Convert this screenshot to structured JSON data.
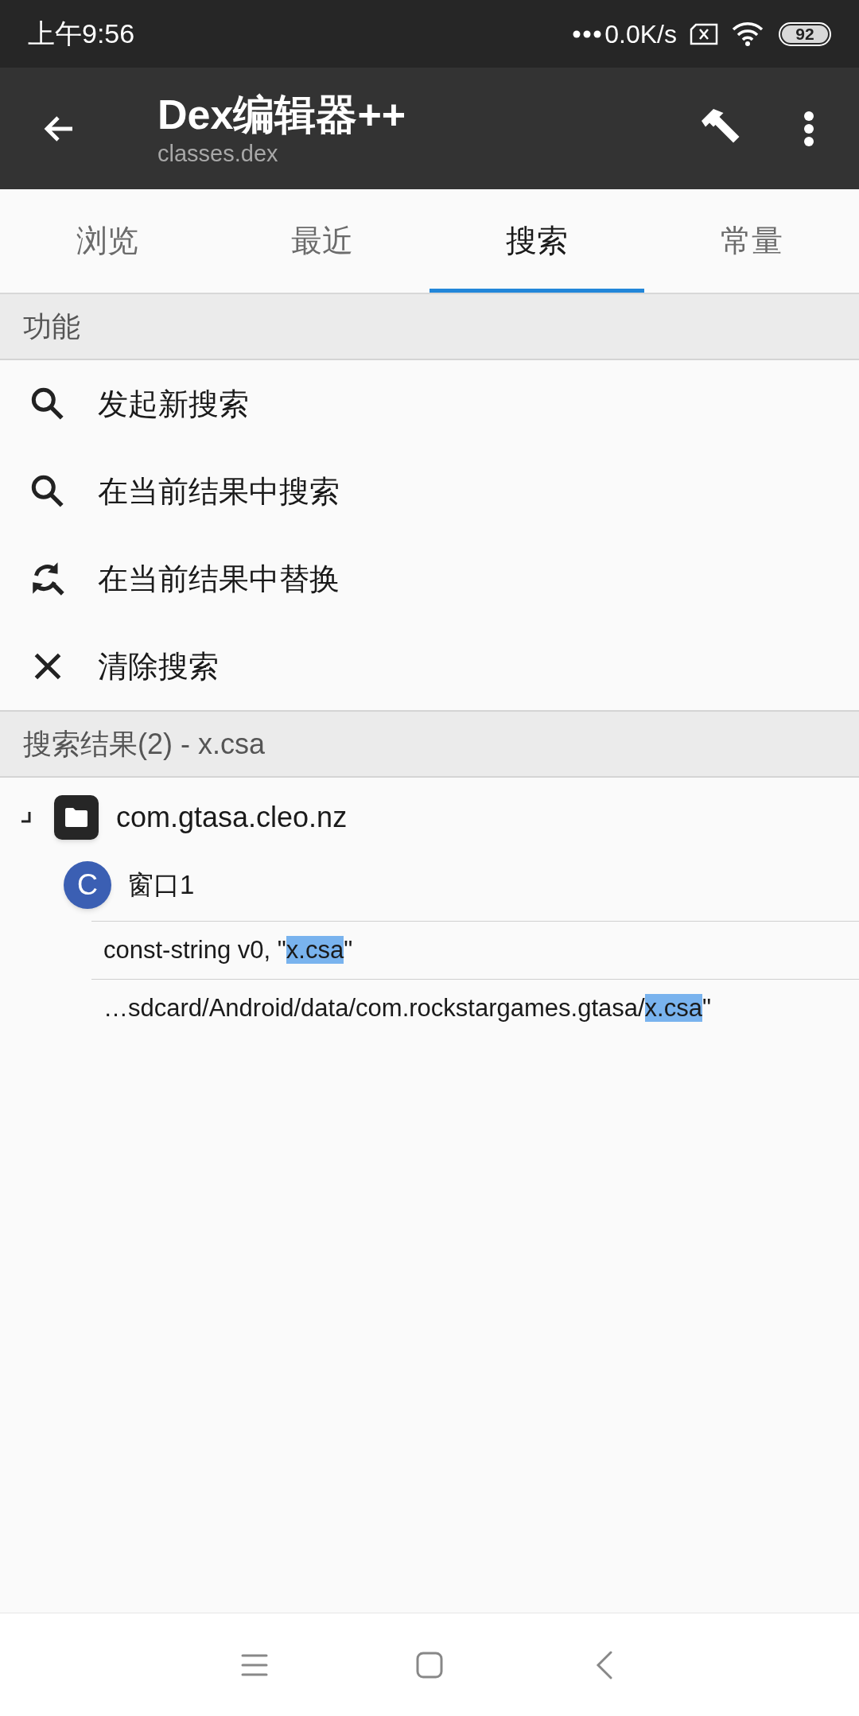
{
  "status_bar": {
    "time": "上午9:56",
    "speed": "0.0K/s",
    "battery": "92"
  },
  "app_bar": {
    "title": "Dex编辑器++",
    "subtitle": "classes.dex"
  },
  "tabs": [
    {
      "label": "浏览",
      "selected": false
    },
    {
      "label": "最近",
      "selected": false
    },
    {
      "label": "搜索",
      "selected": true
    },
    {
      "label": "常量",
      "selected": false
    }
  ],
  "functions": {
    "header": "功能",
    "items": [
      {
        "kind": "search",
        "label": "发起新搜索"
      },
      {
        "kind": "search",
        "label": "在当前结果中搜索"
      },
      {
        "kind": "replace",
        "label": "在当前结果中替换"
      },
      {
        "kind": "clear",
        "label": "清除搜索"
      }
    ]
  },
  "results": {
    "header": "搜索结果(2) - x.csa",
    "tree": [
      {
        "label": "com.gtasa.cleo.nz",
        "expanded": true,
        "children": [
          {
            "badge": "C",
            "label": "窗口1",
            "children": [
              {
                "before": "const-string v0, \"",
                "match": "x.csa",
                "after": "\""
              },
              {
                "before": "…sdcard/Android/data/com.rockstargames.gtasa/",
                "match": "x.csa",
                "after": "\""
              }
            ]
          }
        ]
      }
    ]
  }
}
